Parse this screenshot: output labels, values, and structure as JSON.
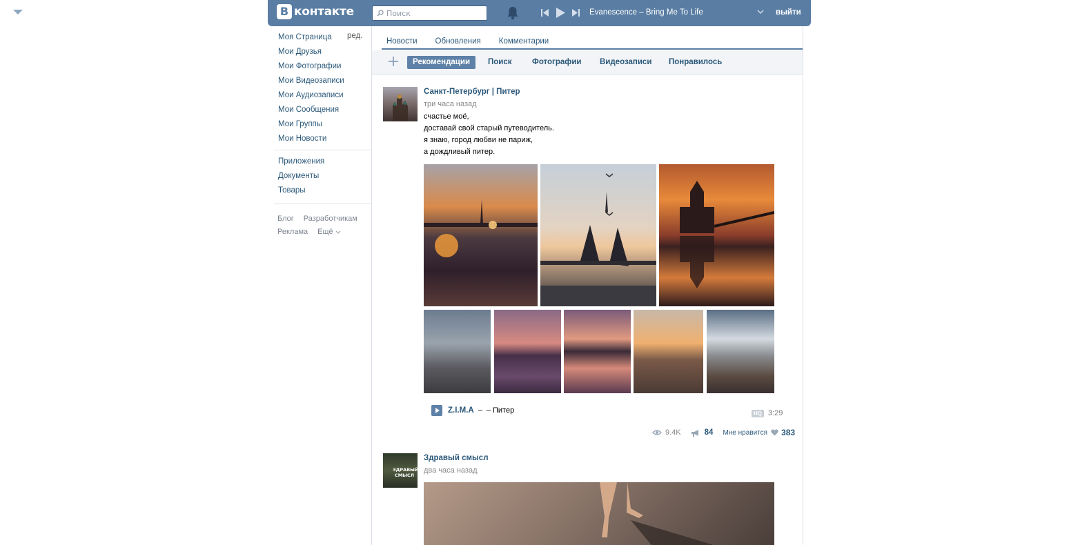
{
  "header": {
    "logo_badge": "В",
    "logo_text": "контакте",
    "search_placeholder": "Поиск",
    "now_playing": "Evanescence – Bring Me To Life",
    "logout": "выйти",
    "bg_color": "#597da3"
  },
  "sidebar": {
    "edit_label": "ред.",
    "items": [
      {
        "label": "Моя Страница"
      },
      {
        "label": "Мои Друзья"
      },
      {
        "label": "Мои Фотографии"
      },
      {
        "label": "Мои Видеозаписи"
      },
      {
        "label": "Мои Аудиозаписи"
      },
      {
        "label": "Мои Сообщения"
      },
      {
        "label": "Мои Группы"
      },
      {
        "label": "Мои Новости"
      }
    ],
    "apps": [
      {
        "label": "Приложения"
      },
      {
        "label": "Документы"
      },
      {
        "label": "Товары"
      }
    ],
    "footer": {
      "blog": "Блог",
      "developers": "Разработчикам",
      "ads": "Реклама",
      "more": "Ещё"
    }
  },
  "tabs": [
    {
      "label": "Новости"
    },
    {
      "label": "Обновления"
    },
    {
      "label": "Комментарии"
    }
  ],
  "subtabs": [
    {
      "label": "Рекомендации",
      "active": true
    },
    {
      "label": "Поиск"
    },
    {
      "label": "Фотографии"
    },
    {
      "label": "Видеозаписи"
    },
    {
      "label": "Понравилось"
    }
  ],
  "posts": [
    {
      "author": "Санкт-Петербург | Питер",
      "time": "три часа назад",
      "text": [
        "счастье моё,",
        "доставай свой старый путеводитель.",
        "я знаю, город любви не париж,",
        "а дождливый питер."
      ],
      "audio": {
        "artist": "Z.I.M.A",
        "separator": "–",
        "title": "– Питер",
        "hq": "HQ",
        "duration": "3:29"
      },
      "stats": {
        "views": "9.4K",
        "reposts": "84",
        "like_label": "Мне нравится",
        "likes": "383"
      }
    },
    {
      "author": "Здравый смысл",
      "time": "два часа назад",
      "avatar_text": "ЗДРАВЫЙ СМЫСЛ"
    }
  ]
}
